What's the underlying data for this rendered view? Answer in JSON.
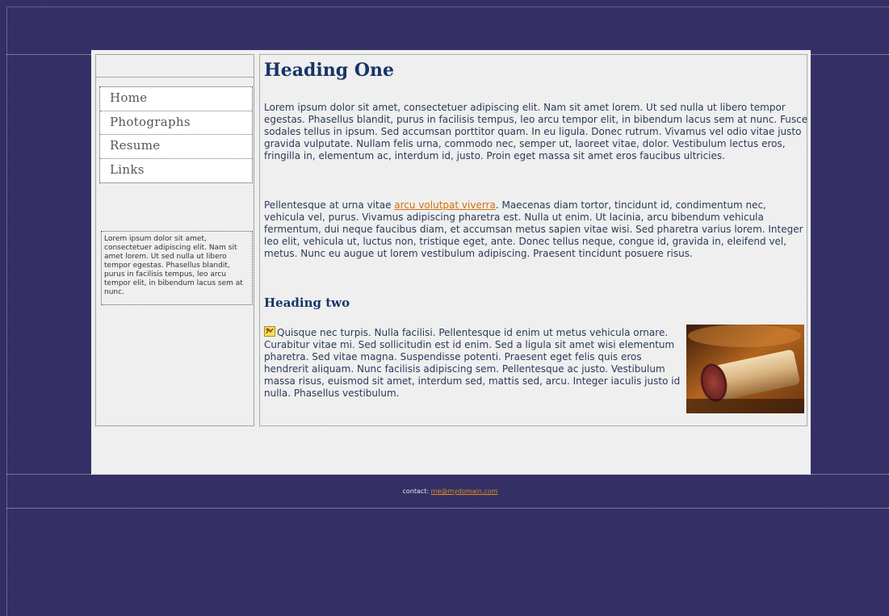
{
  "nav": {
    "items": [
      {
        "label": "Home"
      },
      {
        "label": "Photographs"
      },
      {
        "label": "Resume"
      },
      {
        "label": "Links"
      }
    ]
  },
  "sidebar": {
    "box_text": "Lorem ipsum dolor sit amet, consectetuer adipiscing elit. Nam sit amet lorem. Ut sed nulla ut libero tempor egestas. Phasellus blandit, purus in facilisis tempus, leo arcu tempor elit, in bibendum lacus sem at nunc."
  },
  "content": {
    "heading_one": "Heading One",
    "paragraph_one": "Lorem ipsum dolor sit amet, consectetuer adipiscing elit. Nam sit amet lorem. Ut sed nulla ut libero tempor egestas. Phasellus blandit, purus in facilisis tempus, leo arcu tempor elit, in bibendum lacus sem at nunc. Fusce sodales tellus in ipsum. Sed accumsan porttitor quam. In eu ligula. Donec rutrum. Vivamus vel odio vitae justo gravida vulputate. Nullam felis urna, commodo nec, semper ut, laoreet vitae, dolor. Vestibulum lectus eros, fringilla in, elementum ac, interdum id, justo. Proin eget massa sit amet eros faucibus ultricies.",
    "paragraph_two_before": "Pellentesque at urna vitae ",
    "paragraph_two_link": "arcu volutpat viverra",
    "paragraph_two_after": ". Maecenas diam tortor, tincidunt id, condimentum nec, vehicula vel, purus. Vivamus adipiscing pharetra est. Nulla ut enim. Ut lacinia, arcu bibendum vehicula fermentum, dui neque faucibus diam, et accumsan metus sapien vitae wisi. Sed pharetra varius lorem. Integer leo elit, vehicula ut, luctus non, tristique eget, ante. Donec tellus neque, congue id, gravida in, eleifend vel, metus. Nunc eu augue ut lorem vestibulum adipiscing. Praesent tincidunt posuere risus.",
    "heading_two": "Heading two",
    "paragraph_three": "Quisque nec turpis. Nulla facilisi. Pellentesque id enim ut metus vehicula ornare. Curabitur vitae mi. Sed sollicitudin est id enim. Sed a ligula sit amet wisi elementum pharetra. Sed vitae magna. Suspendisse potenti. Praesent eget felis quis eros hendrerit aliquam. Nunc facilisis adipiscing sem. Pellentesque ac justo. Vestibulum massa risus, euismod sit amet, interdum sed, mattis sed, arcu. Integer iaculis justo id nulla. Phasellus vestibulum."
  },
  "footer": {
    "contact_label": "contact: ",
    "email": "me@mydomain.com"
  },
  "colors": {
    "page_background": "#343065",
    "wrapper_background": "#efefef",
    "heading": "#163568",
    "link": "#d4700a"
  },
  "icons": {
    "inline_icon": "broken-image-icon",
    "photo": "wine-cork-photo"
  }
}
